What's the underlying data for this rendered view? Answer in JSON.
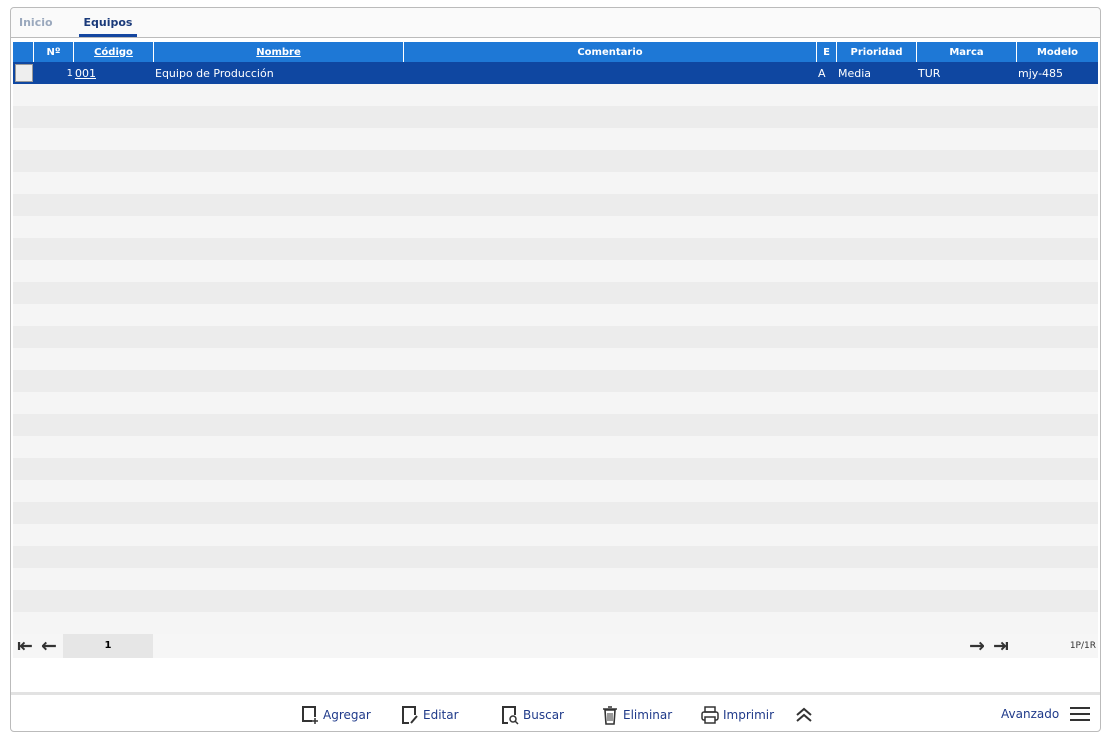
{
  "tabs": [
    "Inicio",
    "Equipos"
  ],
  "columns": [
    "Nº",
    "Código",
    "Nombre",
    "Comentario",
    "E",
    "Prioridad",
    "Marca",
    "Modelo"
  ],
  "rows": [
    {
      "n": "1",
      "codigo": "001",
      "nombre": "Equipo de Producción",
      "comentario": "",
      "e": "A",
      "prioridad": "Media",
      "marca": "TUR",
      "modelo": "mjy-485"
    }
  ],
  "pager": {
    "page": "1",
    "info": "1P/1R"
  },
  "toolbar": {
    "add": "Agregar",
    "edit": "Editar",
    "search": "Buscar",
    "delete": "Eliminar",
    "print": "Imprimir",
    "advanced": "Avanzado"
  }
}
